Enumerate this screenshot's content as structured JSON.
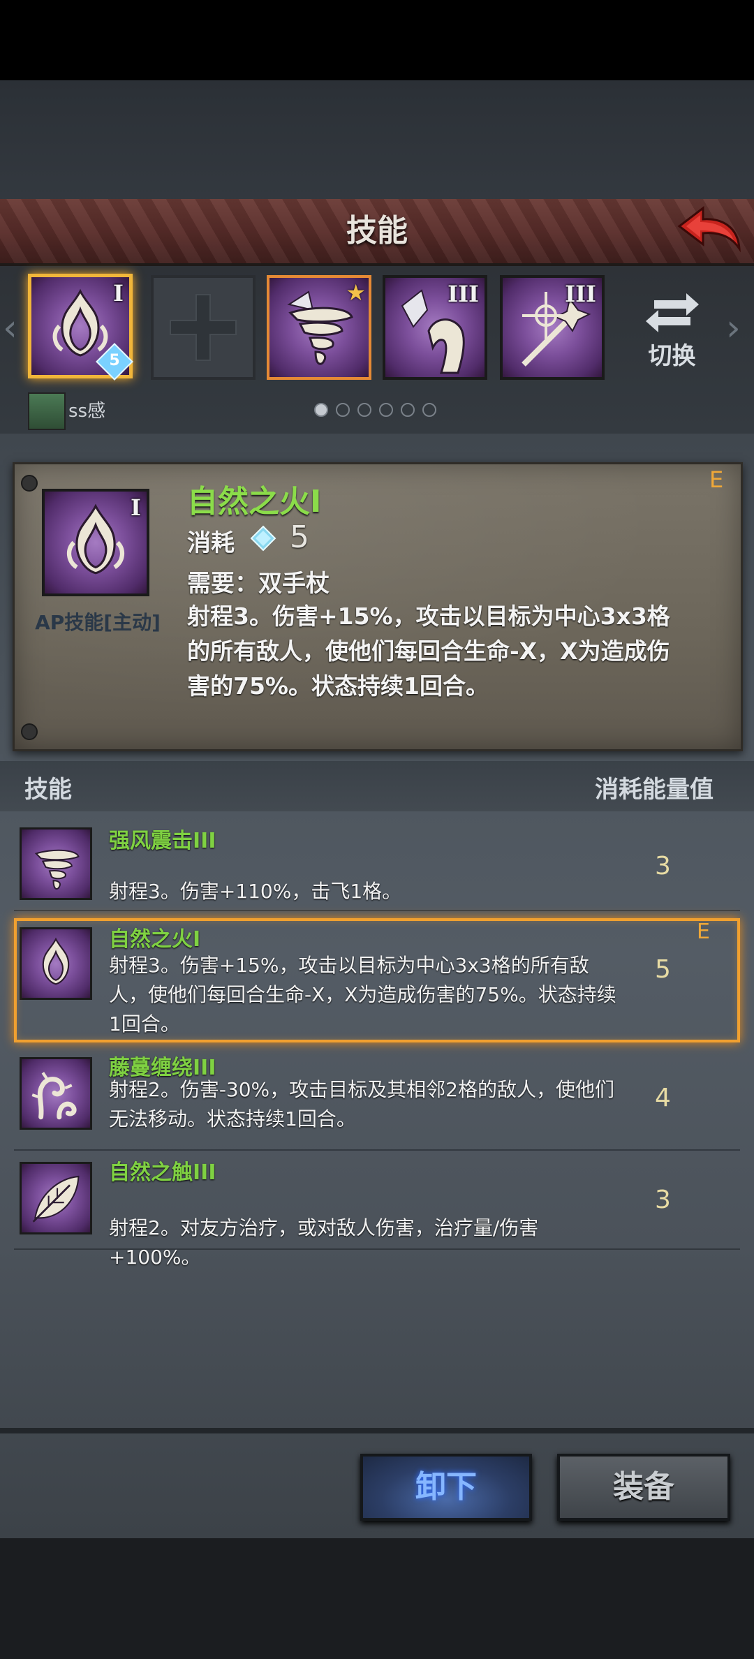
{
  "header": {
    "title": "技能"
  },
  "slots": [
    {
      "name": "自然之火",
      "roman": "I",
      "badge": "5",
      "selected": true
    },
    {
      "name": "",
      "roman": "",
      "empty": true
    },
    {
      "name": "强风震击",
      "roman": "",
      "starred": true
    },
    {
      "name": "藤蔓缠绕",
      "roman": "III"
    },
    {
      "name": "法杖技能",
      "roman": "III"
    }
  ],
  "switch_label": "切换",
  "user": {
    "name": "ss感"
  },
  "pager": {
    "count": 6,
    "active": 0
  },
  "detail": {
    "name": "自然之火I",
    "grade": "E",
    "cost_label": "消耗",
    "cost_value": "5",
    "requirement": "需要：双手杖",
    "type": "AP技能[主动]",
    "roman": "I",
    "description": "射程3。伤害+15%，攻击以目标为中心3x3格的所有敌人，使他们每回合生命-X，X为造成伤害的75%。状态持续1回合。"
  },
  "list": {
    "header_skill": "技能",
    "header_cost": "消耗能量值",
    "rows": [
      {
        "name": "强风震击III",
        "desc": "射程3。伤害+110%，击飞1格。",
        "cost": "3",
        "icon": "tornado-icon"
      },
      {
        "name": "自然之火I",
        "desc": "射程3。伤害+15%，攻击以目标为中心3x3格的所有敌人，使他们每回合生命-X，X为造成伤害的75%。状态持续1回合。",
        "cost": "5",
        "grade": "E",
        "icon": "flame-icon",
        "selected": true
      },
      {
        "name": "藤蔓缠绕III",
        "desc": "射程2。伤害-30%，攻击目标及其相邻2格的敌人，使他们无法移动。状态持续1回合。",
        "cost": "4",
        "icon": "vine-icon"
      },
      {
        "name": "自然之触III",
        "desc": "射程2。对友方治疗，或对敌人伤害，治疗量/伤害+100%。",
        "cost": "3",
        "icon": "leaf-icon"
      }
    ]
  },
  "buttons": {
    "unequip": "卸下",
    "equip": "装备"
  },
  "colors": {
    "accent": "#f0a030",
    "skill_name": "#7fd142",
    "unequip_text": "#86b6ff"
  }
}
